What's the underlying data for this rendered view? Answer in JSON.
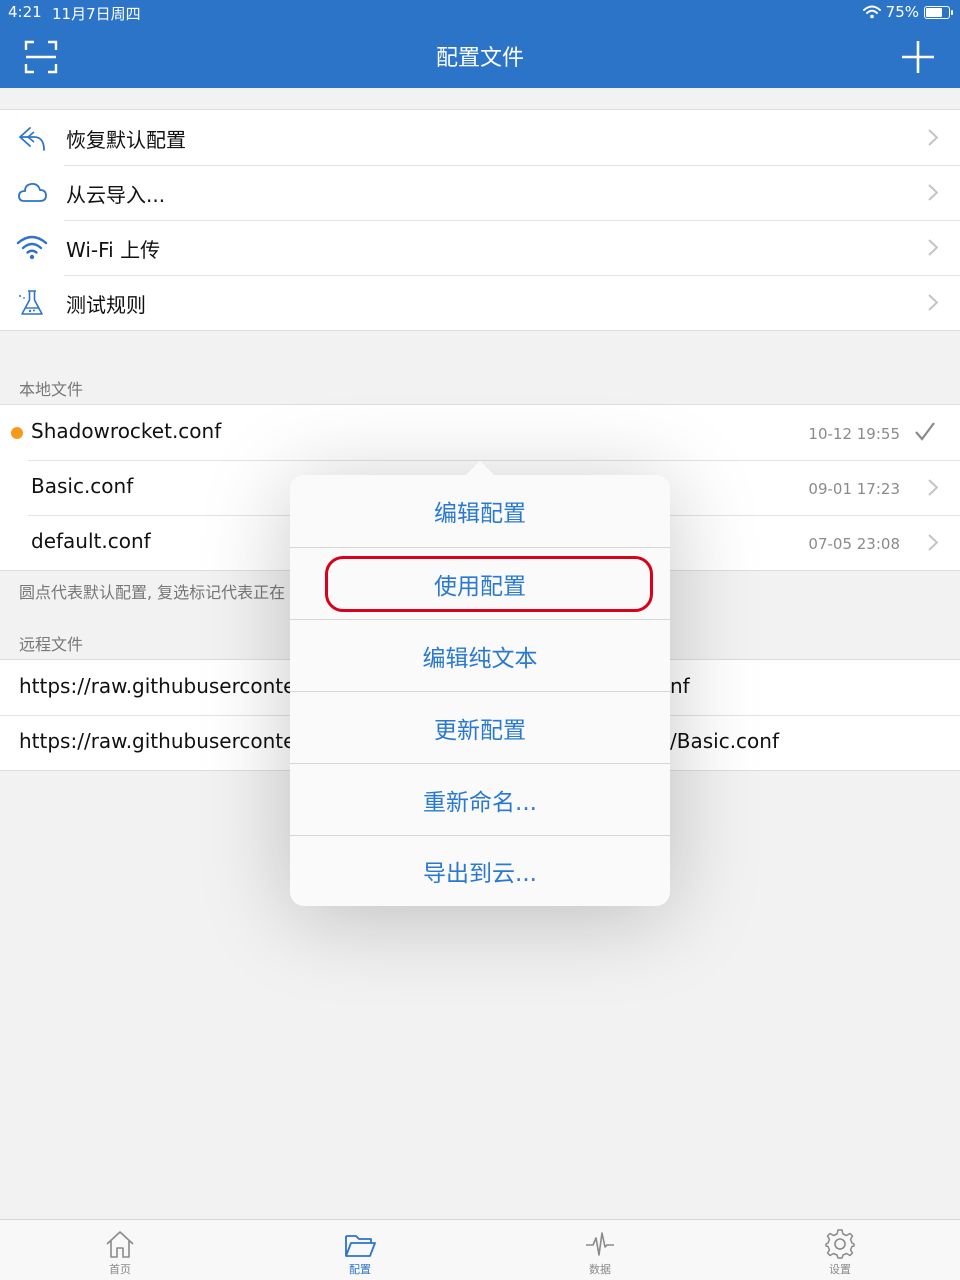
{
  "status": {
    "time": "4:21",
    "date": "11月7日周四",
    "battery_text": "75%",
    "battery_level": 0.75
  },
  "nav": {
    "title": "配置文件"
  },
  "menu_items": [
    {
      "label": "恢复默认配置",
      "icon": "undo-arrow-icon"
    },
    {
      "label": "从云导入...",
      "icon": "cloud-icon"
    },
    {
      "label": "Wi-Fi 上传",
      "icon": "wifi-icon"
    },
    {
      "label": "测试规则",
      "icon": "flask-icon"
    }
  ],
  "local": {
    "header": "本地文件",
    "files": [
      {
        "name": "Shadowrocket.conf",
        "time": "10-12 19:55",
        "default": true,
        "selected": true
      },
      {
        "name": "Basic.conf",
        "time": "09-01 17:23"
      },
      {
        "name": "default.conf",
        "time": "07-05 23:08"
      }
    ],
    "footnote": "圆点代表默认配置, 复选标记代表正在"
  },
  "remote": {
    "header": "远程文件",
    "files": [
      {
        "prefix": "https://raw.githubusercontent.",
        "suffix": "nf"
      },
      {
        "prefix": "https://raw.githubusercontent.",
        "suffix": "/Basic.conf"
      }
    ]
  },
  "popover": {
    "items": [
      "编辑配置",
      "使用配置",
      "编辑纯文本",
      "更新配置",
      "重新命名...",
      "导出到云..."
    ],
    "highlighted_index": 1
  },
  "tabs": [
    {
      "label": "首页",
      "icon": "home-icon"
    },
    {
      "label": "配置",
      "icon": "folder-icon",
      "active": true
    },
    {
      "label": "数据",
      "icon": "pulse-icon"
    },
    {
      "label": "设置",
      "icon": "gear-icon"
    }
  ],
  "colors": {
    "accent": "#2c74c7",
    "link": "#2a79cf",
    "highlight": "#d8001a",
    "default_dot": "#f79a1c"
  }
}
